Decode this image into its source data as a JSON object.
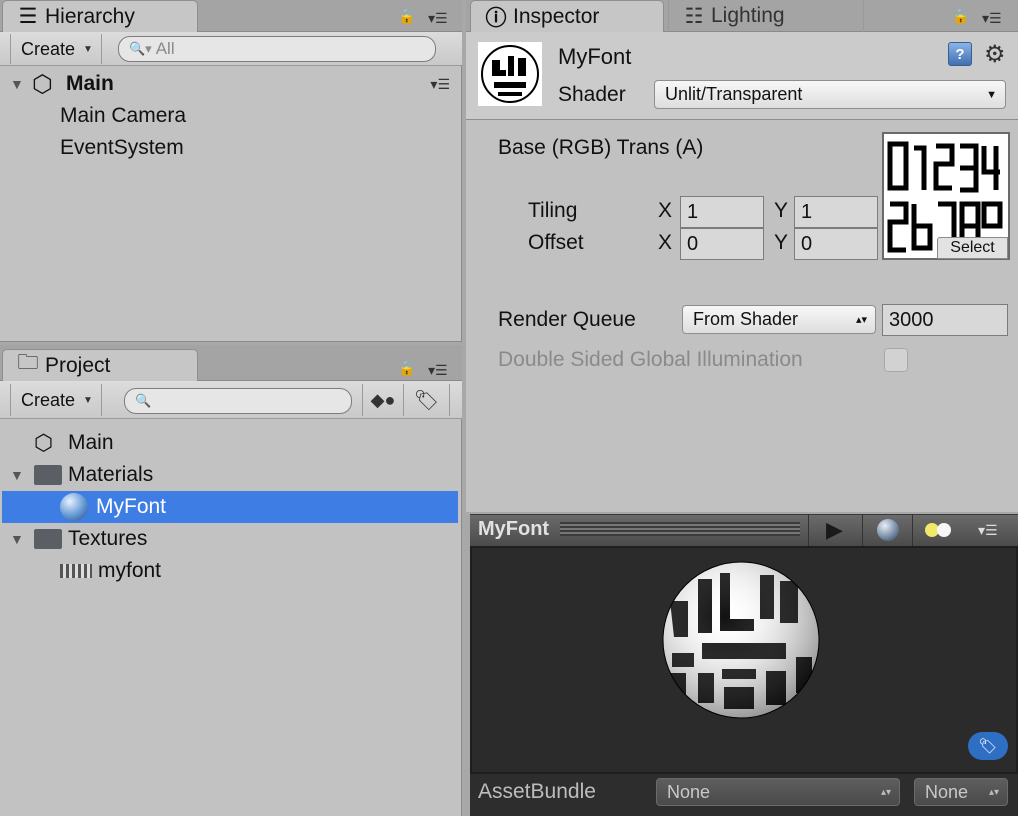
{
  "hierarchy": {
    "tab_label": "Hierarchy",
    "create_label": "Create",
    "search_placeholder": "All",
    "scene_name": "Main",
    "items": [
      "Main Camera",
      "EventSystem"
    ]
  },
  "project": {
    "tab_label": "Project",
    "create_label": "Create",
    "search_placeholder": "",
    "tree": [
      {
        "label": "Main",
        "icon": "unity-scene-icon",
        "level": 0
      },
      {
        "label": "Materials",
        "icon": "folder-icon",
        "level": 0,
        "expanded": true
      },
      {
        "label": "MyFont",
        "icon": "material-sphere-icon",
        "level": 1,
        "selected": true
      },
      {
        "label": "Textures",
        "icon": "folder-icon",
        "level": 0,
        "expanded": true
      },
      {
        "label": "myfont",
        "icon": "texture-thumb-icon",
        "level": 1
      }
    ]
  },
  "inspector": {
    "tab_label": "Inspector",
    "lighting_tab_label": "Lighting",
    "material_name": "MyFont",
    "shader_label": "Shader",
    "shader_value": "Unlit/Transparent",
    "texture_property_label": "Base (RGB) Trans (A)",
    "tiling_label": "Tiling",
    "offset_label": "Offset",
    "x_label": "X",
    "y_label": "Y",
    "tiling_x": "1",
    "tiling_y": "1",
    "offset_x": "0",
    "offset_y": "0",
    "select_label": "Select",
    "render_queue_label": "Render Queue",
    "render_queue_mode": "From Shader",
    "render_queue_value": "3000",
    "double_sided_label": "Double Sided Global Illumination",
    "double_sided_checked": false
  },
  "preview": {
    "title": "MyFont",
    "assetbundle_label": "AssetBundle",
    "assetbundle_name": "None",
    "assetbundle_variant": "None"
  },
  "colors": {
    "selection": "#3e7de4",
    "panel": "#c2c2c2",
    "preview_bg": "#2b2b2b"
  }
}
